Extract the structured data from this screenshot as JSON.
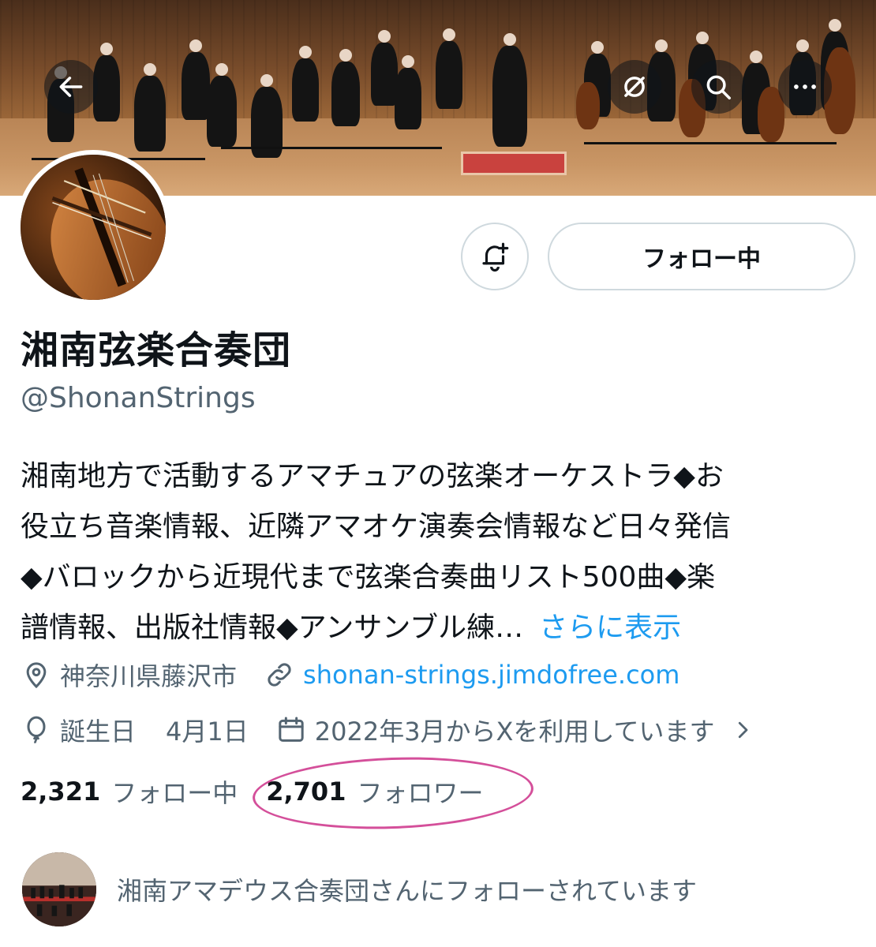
{
  "header": {
    "back_icon": "arrow-left-icon",
    "icons": [
      "hide-icon",
      "search-icon",
      "more-icon"
    ]
  },
  "actions": {
    "notify_icon": "bell-plus-icon",
    "follow_label": "フォロー中"
  },
  "profile": {
    "name": "湘南弦楽合奏団",
    "handle": "@ShonanStrings",
    "bio_lines": [
      "湘南地方で活動するアマチュアの弦楽オーケストラ◆お",
      "役立ち音楽情報、近隣アマオケ演奏会情報など日々発信",
      "◆バロックから近現代まで弦楽合奏曲リスト500曲◆楽",
      "譜情報、出版社情報◆アンサンブル練…"
    ],
    "bio_more": "さらに表示",
    "location": "神奈川県藤沢市",
    "website": "shonan-strings.jimdofree.com",
    "birthday_label": "誕生日",
    "birthday": "4月1日",
    "joined": "2022年3月からXを利用しています"
  },
  "stats": {
    "following_count": "2,321",
    "following_label": "フォロー中",
    "followers_count": "2,701",
    "followers_label": "フォロワー"
  },
  "followed_by": {
    "text": "湘南アマデウス合奏団さんにフォローされています"
  },
  "colors": {
    "link": "#1d9bf0",
    "secondary_text": "#536471",
    "annotation_circle": "#d44f9a"
  }
}
